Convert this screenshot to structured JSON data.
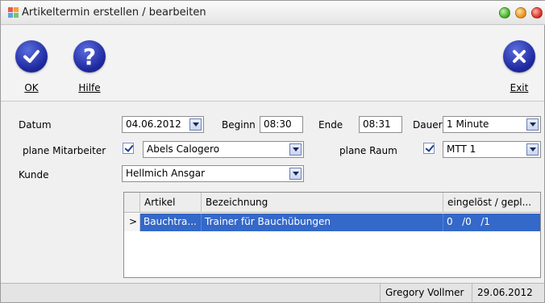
{
  "window": {
    "title": "Artikeltermin erstellen / bearbeiten"
  },
  "toolbar": {
    "ok_label": "OK",
    "help_label": "Hilfe",
    "exit_label": "Exit"
  },
  "form": {
    "datum_label": "Datum",
    "datum_value": "04.06.2012",
    "beginn_label": "Beginn",
    "beginn_value": "08:30",
    "ende_label": "Ende",
    "ende_value": "08:31",
    "dauer_label": "Dauer",
    "dauer_value": "1 Minute",
    "mitarbeiter_label": "plane Mitarbeiter",
    "mitarbeiter_checked": true,
    "mitarbeiter_value": "Abels Calogero",
    "raum_label": "plane Raum",
    "raum_checked": true,
    "raum_value": "MTT 1",
    "kunde_label": "Kunde",
    "kunde_value": "Hellmich Ansgar"
  },
  "grid": {
    "columns": [
      "Artikel",
      "Bezeichnung",
      "eingelöst / gepl..."
    ],
    "rows": [
      {
        "indicator": ">",
        "artikel": "Bauchtra...",
        "bezeichnung": "Trainer für Bauchübungen",
        "eingeloest": "0   /0   /1"
      }
    ]
  },
  "status": {
    "user": "Gregory Vollmer",
    "date": "29.06.2012"
  },
  "colors": {
    "accent": "#1f2aa0",
    "selection": "#3468c9"
  },
  "icons": [
    "app-icon",
    "checkmark-icon",
    "question-icon",
    "close-icon",
    "dropdown-arrow-icon"
  ]
}
